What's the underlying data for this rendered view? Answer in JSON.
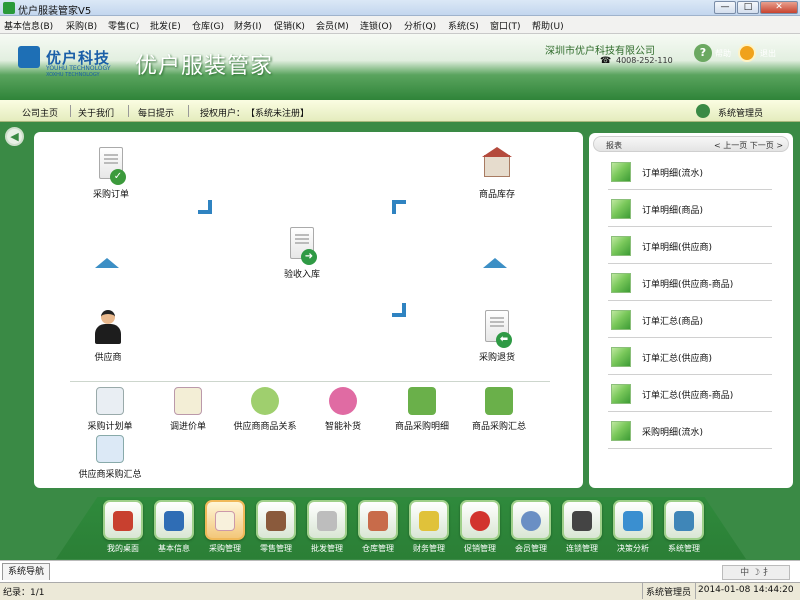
{
  "window": {
    "title": "优户服装管家V5",
    "controls": [
      "—",
      "□",
      "✕"
    ]
  },
  "menu": [
    "基本信息(B)",
    "采购(B)",
    "零售(C)",
    "批发(E)",
    "仓库(G)",
    "财务(I)",
    "促销(K)",
    "会员(M)",
    "连锁(O)",
    "分析(Q)",
    "系统(S)",
    "窗口(T)",
    "帮助(U)"
  ],
  "header": {
    "logo_cn": "优户科技",
    "logo_en": "YOUHU TECHNOLOGY",
    "logo_en2": "XOXHU TECHNOLOGY",
    "app_title": "优户服装管家",
    "company": "深圳市优户科技有限公司",
    "phone": "4008-252-110",
    "help": "帮助",
    "exit": "退出"
  },
  "nav": {
    "home": "公司主页",
    "about": "关于我们",
    "tip": "每日提示",
    "license_label": "授权用户：",
    "license_value": "【系统未注册】",
    "user": "系统管理员"
  },
  "flow": {
    "purchase_order": "采购订单",
    "inventory": "商品库存",
    "receive": "验收入库",
    "supplier": "供应商",
    "return": "采购退货"
  },
  "subfuncs": [
    "采购计划单",
    "调进价单",
    "供应商商品关系",
    "智能补货",
    "商品采购明细",
    "商品采购汇总",
    "供应商采购汇总"
  ],
  "reports": {
    "title": "报表",
    "prev": "< 上一页",
    "next": "下一页 >",
    "items": [
      "订单明细(流水)",
      "订单明细(商品)",
      "订单明细(供应商)",
      "订单明细(供应商-商品)",
      "订单汇总(商品)",
      "订单汇总(供应商)",
      "订单汇总(供应商-商品)",
      "采购明细(流水)"
    ]
  },
  "dock": [
    "我的桌面",
    "基本信息",
    "采购管理",
    "零售管理",
    "批发管理",
    "仓库管理",
    "财务管理",
    "促销管理",
    "会员管理",
    "连锁管理",
    "决策分析",
    "系统管理"
  ],
  "dock_active": 2,
  "tabs": {
    "nav": "系统导航"
  },
  "ime": "中 ☽ 扌",
  "status": {
    "records": "纪录：1/1",
    "user": "系统管理员",
    "time": "2014-01-08 14:44:20"
  },
  "colors": {
    "green": "#3a8a45",
    "accent_blue": "#2f83c1",
    "orange": "#f0a21c"
  }
}
